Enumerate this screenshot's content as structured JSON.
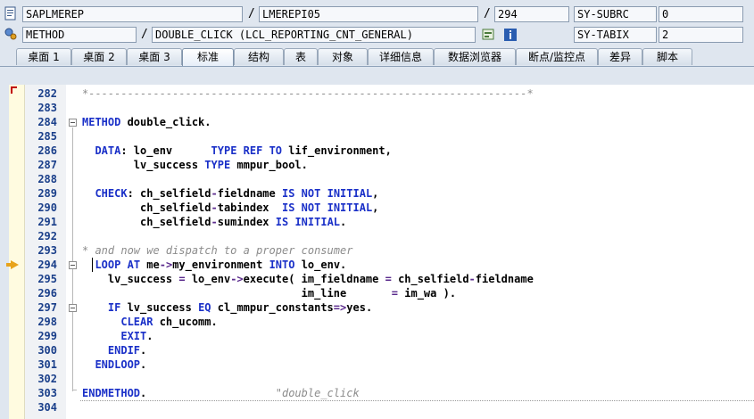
{
  "header": {
    "row1": {
      "program": "SAPLMEREP",
      "include": "LMEREPI05",
      "line": "294",
      "var_name": "SY-SUBRC",
      "var_value": "0"
    },
    "row2": {
      "event_type": "METHOD",
      "event_name": "DOUBLE_CLICK (LCL_REPORTING_CNT_GENERAL)",
      "var_name": "SY-TABIX",
      "var_value": "2"
    },
    "separator": "/"
  },
  "tabs": [
    {
      "label": "桌面 1"
    },
    {
      "label": "桌面 2"
    },
    {
      "label": "桌面 3"
    },
    {
      "label": "标准",
      "active": true
    },
    {
      "label": "结构"
    },
    {
      "label": "表"
    },
    {
      "label": "对象"
    },
    {
      "label": "详细信息"
    },
    {
      "label": "数据浏览器"
    },
    {
      "label": "断点/监控点"
    },
    {
      "label": "差异"
    },
    {
      "label": "脚本"
    }
  ],
  "editor": {
    "current_line": "294",
    "lines": [
      {
        "n": "282",
        "t": "*--------------------------------------------------------------------*"
      },
      {
        "n": "283",
        "t": ""
      },
      {
        "n": "284",
        "t": "METHOD double_click."
      },
      {
        "n": "285",
        "t": ""
      },
      {
        "n": "286",
        "t": "  DATA: lo_env      TYPE REF TO lif_environment,"
      },
      {
        "n": "287",
        "t": "        lv_success TYPE mmpur_bool."
      },
      {
        "n": "288",
        "t": ""
      },
      {
        "n": "289",
        "t": "  CHECK: ch_selfield-fieldname IS NOT INITIAL,"
      },
      {
        "n": "290",
        "t": "         ch_selfield-tabindex  IS NOT INITIAL,"
      },
      {
        "n": "291",
        "t": "         ch_selfield-sumindex IS INITIAL."
      },
      {
        "n": "292",
        "t": ""
      },
      {
        "n": "293",
        "t": "* and now we dispatch to a proper consumer"
      },
      {
        "n": "294",
        "t": "  LOOP AT me->my_environment INTO lo_env."
      },
      {
        "n": "295",
        "t": "    lv_success = lo_env->execute( im_fieldname = ch_selfield-fieldname"
      },
      {
        "n": "296",
        "t": "                                  im_line       = im_wa )."
      },
      {
        "n": "297",
        "t": "    IF lv_success EQ cl_mmpur_constants=>yes."
      },
      {
        "n": "298",
        "t": "      CLEAR ch_ucomm."
      },
      {
        "n": "299",
        "t": "      EXIT."
      },
      {
        "n": "300",
        "t": "    ENDIF."
      },
      {
        "n": "301",
        "t": "  ENDLOOP."
      },
      {
        "n": "302",
        "t": ""
      },
      {
        "n": "303",
        "t": "ENDMETHOD.                    \"double_click"
      },
      {
        "n": "304",
        "t": ""
      }
    ]
  },
  "icons": {
    "row1": "program-icon",
    "row2": "method-icon",
    "row2_b1": "display-object-icon",
    "row2_b2": "info-icon",
    "exec_marker": "current-statement-arrow-icon"
  }
}
